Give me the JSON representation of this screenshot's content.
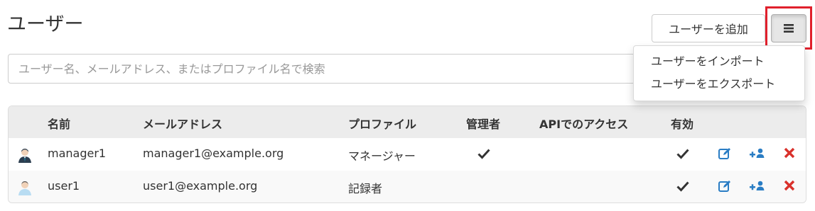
{
  "page": {
    "title": "ユーザー"
  },
  "toolbar": {
    "add_user_label": "ユーザーを追加"
  },
  "dropdown_menu": {
    "items": [
      {
        "label": "ユーザーをインポート"
      },
      {
        "label": "ユーザーをエクスポート"
      }
    ]
  },
  "search": {
    "placeholder": "ユーザー名、メールアドレス、またはプロファイル名で検索",
    "value": ""
  },
  "table": {
    "columns": [
      "名前",
      "メールアドレス",
      "プロファイル",
      "管理者",
      "APIでのアクセス",
      "有効"
    ],
    "rows": [
      {
        "name": "manager1",
        "email": "manager1@example.org",
        "profile": "マネージャー",
        "admin": true,
        "api_access": false,
        "enabled": true
      },
      {
        "name": "user1",
        "email": "user1@example.org",
        "profile": "記録者",
        "admin": false,
        "api_access": false,
        "enabled": true
      }
    ]
  },
  "colors": {
    "edit_icon": "#2a7dc4",
    "add_icon": "#2a7dc4",
    "delete_icon": "#d9312b",
    "highlight": "#e0202c"
  },
  "icons": {
    "row_actions": [
      "edit-icon",
      "add-to-group-icon",
      "delete-icon"
    ],
    "menu": "hamburger-icon",
    "check": "checkmark-icon",
    "avatar_manager": "manager-avatar-icon",
    "avatar_user": "user-avatar-icon"
  }
}
